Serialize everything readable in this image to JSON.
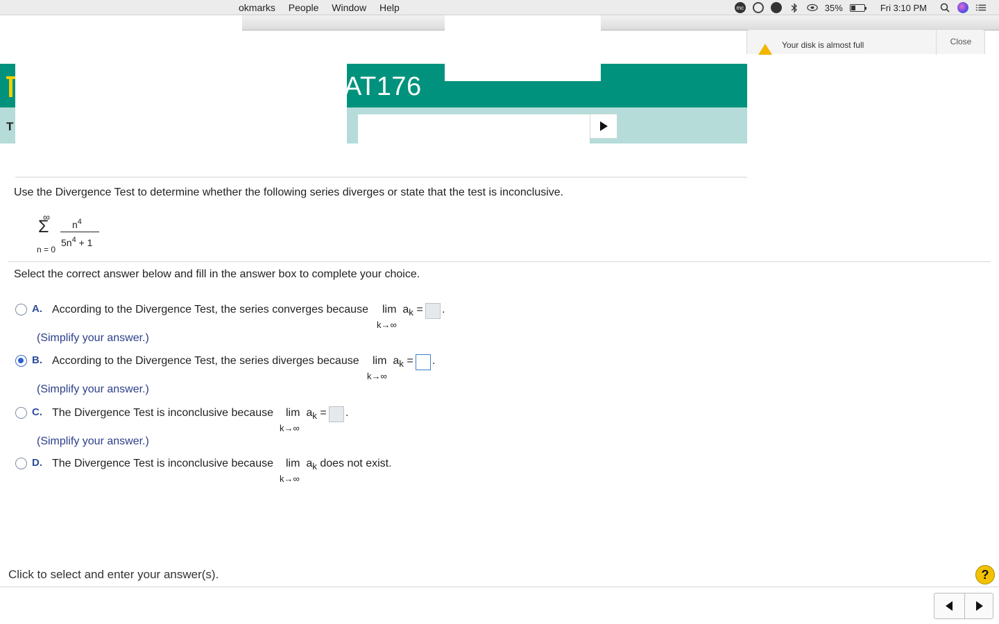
{
  "menubar": {
    "menus": [
      "okmarks",
      "People",
      "Window",
      "Help"
    ],
    "battery_percent": "35%",
    "battery_level": 0.35,
    "clock": "Fri 3:10 PM",
    "icons": [
      "mc-badge-icon",
      "circle-icon",
      "lock-vpn-icon",
      "bluetooth-icon",
      "wifi-icon",
      "battery-icon",
      "search-icon",
      "siri-icon",
      "list-icon"
    ]
  },
  "banner": {
    "title": "AT176",
    "left_mark": "T",
    "sub_mark": "T"
  },
  "notification": {
    "message": "Your disk is almost full",
    "close_label": "Close"
  },
  "question": {
    "prompt": "Use the Divergence Test to determine whether the following series diverges or state that the test is inconclusive.",
    "series": {
      "upper": "∞",
      "lower": "n = 0",
      "numerator": "n",
      "numerator_exp": "4",
      "denominator_base": "5n",
      "denominator_exp": "4",
      "denominator_tail": "+ 1"
    },
    "instruction": "Select the correct answer below and fill in the answer box to complete your choice."
  },
  "options": [
    {
      "letter": "A.",
      "text": "According to the Divergence Test, the series converges because",
      "lim": "lim",
      "a": "a",
      "k": "k",
      "eq": "=",
      "under": "k→∞",
      "hint": "(Simplify your answer.)",
      "selected": false
    },
    {
      "letter": "B.",
      "text": "According to the Divergence Test, the series diverges because",
      "lim": "lim",
      "a": "a",
      "k": "k",
      "eq": "=",
      "under": "k→∞",
      "hint": "(Simplify your answer.)",
      "selected": true
    },
    {
      "letter": "C.",
      "text": "The Divergence Test is inconclusive because",
      "lim": "lim",
      "a": "a",
      "k": "k",
      "eq": "=",
      "under": "k→∞",
      "hint": "(Simplify your answer.)",
      "selected": false
    },
    {
      "letter": "D.",
      "text": "The Divergence Test is inconclusive because",
      "lim": "lim",
      "a": "a",
      "k": "k",
      "tail": "does not exist.",
      "under": "k→∞",
      "selected": false
    }
  ],
  "footer": {
    "status": "Click to select and enter your answer(s).",
    "help_label": "?"
  },
  "colors": {
    "banner_teal": "#00927c",
    "banner_light": "#b5dcd8",
    "accent_blue": "#2d4d9a",
    "help_yellow": "#f2c200"
  }
}
